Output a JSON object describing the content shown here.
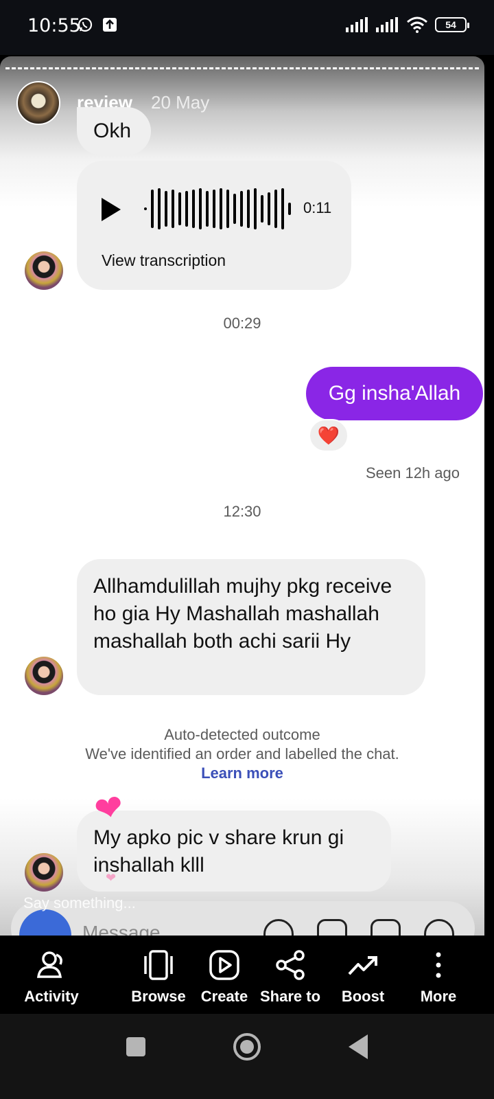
{
  "status_bar": {
    "time": "10:55",
    "battery": "54"
  },
  "story": {
    "username": "review",
    "date": "20 May"
  },
  "chat": {
    "msg1": "Okh",
    "voice": {
      "duration": "0:11",
      "transcription_label": "View transcription"
    },
    "time1": "00:29",
    "sent": "Gg insha'Allah",
    "reaction": "❤️",
    "seen": "Seen 12h ago",
    "time2": "12:30",
    "msg2": "Allhamdulillah mujhy pkg receive ho gia Hy Mashallah mashallah mashallah both achi sarii Hy",
    "notice": {
      "title": "Auto-detected outcome",
      "text": "We've identified an order and labelled the chat.",
      "link": "Learn more"
    },
    "msg3": "My apko pic v share krun gi inshallah klll"
  },
  "reply": {
    "say_something": "Say something...",
    "placeholder": "Message"
  },
  "actions": [
    {
      "label": "Activity",
      "icon": "activity-icon"
    },
    {
      "label": "Browse",
      "icon": "browse-icon"
    },
    {
      "label": "Create",
      "icon": "create-icon"
    },
    {
      "label": "Share to",
      "icon": "share-icon"
    },
    {
      "label": "Boost",
      "icon": "boost-icon"
    },
    {
      "label": "More",
      "icon": "more-icon"
    }
  ],
  "colors": {
    "sent_bubble": "#8a26e6",
    "link": "#3b4fb8",
    "heart": "#ff3e9e"
  }
}
